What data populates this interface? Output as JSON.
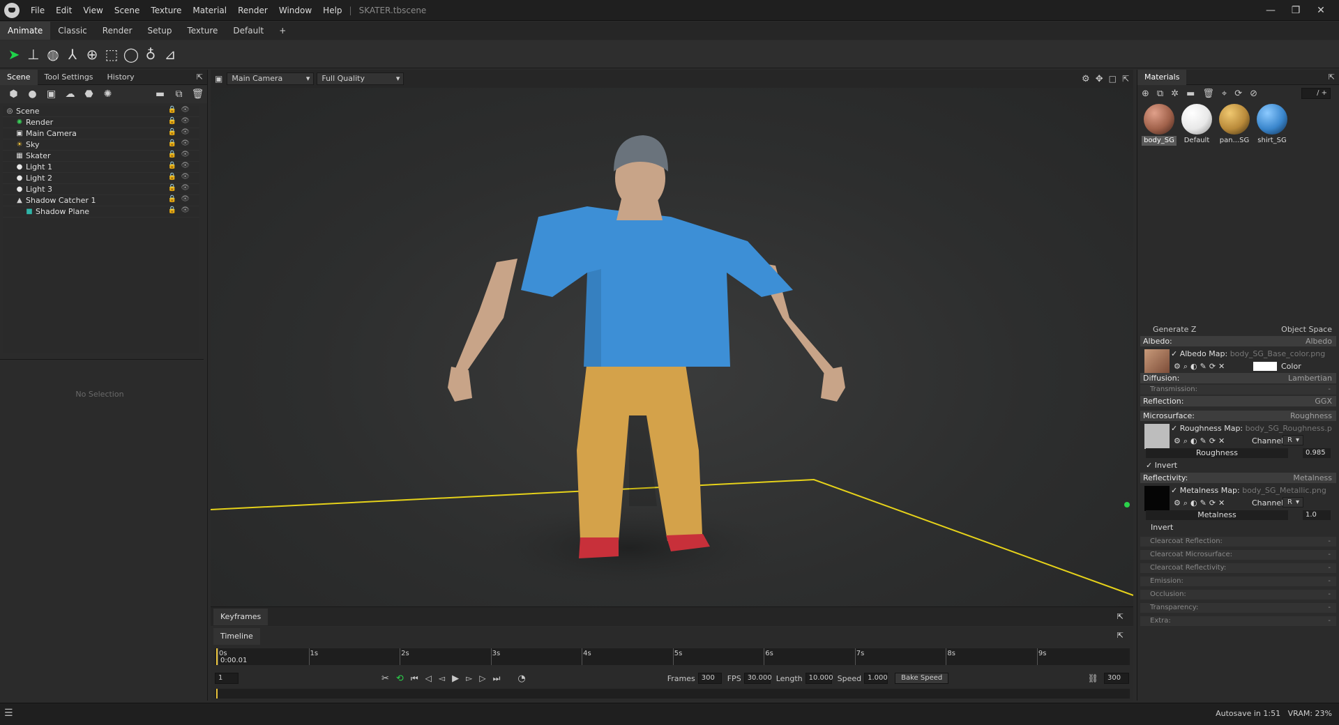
{
  "app": {
    "menu": [
      "File",
      "Edit",
      "View",
      "Scene",
      "Texture",
      "Material",
      "Render",
      "Window",
      "Help"
    ],
    "file_name": "SKATER.tbscene",
    "window_controls": [
      "minimize-icon",
      "maximize-icon",
      "close-icon"
    ]
  },
  "workspace_tabs": [
    {
      "label": "Animate",
      "active": true
    },
    {
      "label": "Classic",
      "active": false
    },
    {
      "label": "Render",
      "active": false
    },
    {
      "label": "Setup",
      "active": false
    },
    {
      "label": "Texture",
      "active": false
    },
    {
      "label": "Default",
      "active": false
    },
    {
      "label": "+",
      "active": false
    }
  ],
  "toolbar": {
    "tools": [
      "select-arrow-icon",
      "translate-icon",
      "rotate-icon",
      "scale-icon",
      "transform-icon",
      "rect-select-icon",
      "circle-select-icon",
      "lasso-select-icon",
      "poly-select-icon"
    ]
  },
  "scene_panel": {
    "tabs": [
      {
        "label": "Scene",
        "active": true
      },
      {
        "label": "Tool Settings",
        "active": false
      },
      {
        "label": "History",
        "active": false
      }
    ],
    "tree": [
      {
        "label": "Scene",
        "depth": 0,
        "icon": "scene-icon"
      },
      {
        "label": "Render",
        "depth": 1,
        "icon": "render-icon"
      },
      {
        "label": "Main Camera",
        "depth": 1,
        "icon": "camera-icon"
      },
      {
        "label": "Sky",
        "depth": 1,
        "icon": "sky-icon"
      },
      {
        "label": "Skater",
        "depth": 1,
        "icon": "mesh-icon"
      },
      {
        "label": "Light 1",
        "depth": 1,
        "icon": "light-icon"
      },
      {
        "label": "Light 2",
        "depth": 1,
        "icon": "light-icon"
      },
      {
        "label": "Light 3",
        "depth": 1,
        "icon": "light-icon"
      },
      {
        "label": "Shadow Catcher 1",
        "depth": 1,
        "icon": "shadow-catcher-icon"
      },
      {
        "label": "Shadow Plane",
        "depth": 2,
        "icon": "plane-icon"
      }
    ],
    "no_selection": "No Selection"
  },
  "viewport": {
    "camera": "Main Camera",
    "quality": "Full Quality",
    "colors": {
      "shirt": "#3d8fd6",
      "pants": "#d4a24a",
      "skin": "#c8a488",
      "beanie": "#6a737c",
      "shoes": "#c8303a",
      "ground_line": "#e6d21a"
    }
  },
  "keyframes": {
    "label": "Keyframes"
  },
  "timeline": {
    "label": "Timeline",
    "ticks": [
      "0s",
      "1s",
      "2s",
      "3s",
      "4s",
      "5s",
      "6s",
      "7s",
      "8s",
      "9s"
    ],
    "current_time": "0:00.01",
    "current_frame": "1",
    "frames_label": "Frames",
    "frames": "300",
    "fps_label": "FPS",
    "fps": "30.000",
    "length_label": "Length",
    "length": "10.000",
    "speed_label": "Speed",
    "speed": "1.000",
    "bake_label": "Bake Speed",
    "end_frame": "300"
  },
  "materials": {
    "title": "Materials",
    "search": "/ +",
    "items": [
      {
        "label": "body_SG",
        "color": "#a0614a",
        "selected": true
      },
      {
        "label": "Default",
        "color": "#e8e8e8",
        "selected": false
      },
      {
        "label": "pan...SG",
        "color": "#b98a3a",
        "selected": false
      },
      {
        "label": "shirt_SG",
        "color": "#3a86cc",
        "selected": false
      }
    ],
    "props": {
      "generate_z": "Generate Z",
      "object_space": "Object Space",
      "albedo": {
        "label": "Albedo:",
        "value": "Albedo",
        "map_label": "Albedo Map:",
        "map_file": "body_SG_Base_color.png",
        "color_label": "Color"
      },
      "diffusion": {
        "label": "Diffusion:",
        "value": "Lambertian"
      },
      "transmission": {
        "label": "Transmission:",
        "value": "-"
      },
      "reflection": {
        "label": "Reflection:",
        "value": "GGX"
      },
      "microsurface": {
        "label": "Microsurface:",
        "value": "Roughness",
        "map_label": "Roughness Map:",
        "map_file": "body_SG_Roughness.p",
        "channel_label": "Channel",
        "channel": "R",
        "slider_label": "Roughness",
        "slider_value": "0.985",
        "invert": "Invert"
      },
      "reflectivity": {
        "label": "Reflectivity:",
        "value": "Metalness",
        "map_label": "Metalness Map:",
        "map_file": "body_SG_Metallic.png",
        "channel_label": "Channel",
        "channel": "R",
        "slider_label": "Metalness",
        "slider_value": "1.0",
        "invert": "Invert"
      },
      "extras": [
        {
          "label": "Clearcoat Reflection:",
          "value": "-"
        },
        {
          "label": "Clearcoat Microsurface:",
          "value": "-"
        },
        {
          "label": "Clearcoat Reflectivity:",
          "value": "-"
        },
        {
          "label": "Emission:",
          "value": "-"
        },
        {
          "label": "Occlusion:",
          "value": "-"
        },
        {
          "label": "Transparency:",
          "value": "-"
        },
        {
          "label": "Extra:",
          "value": "-"
        }
      ]
    }
  },
  "status": {
    "autosave": "Autosave in 1:51",
    "vram": "VRAM: 23%"
  }
}
